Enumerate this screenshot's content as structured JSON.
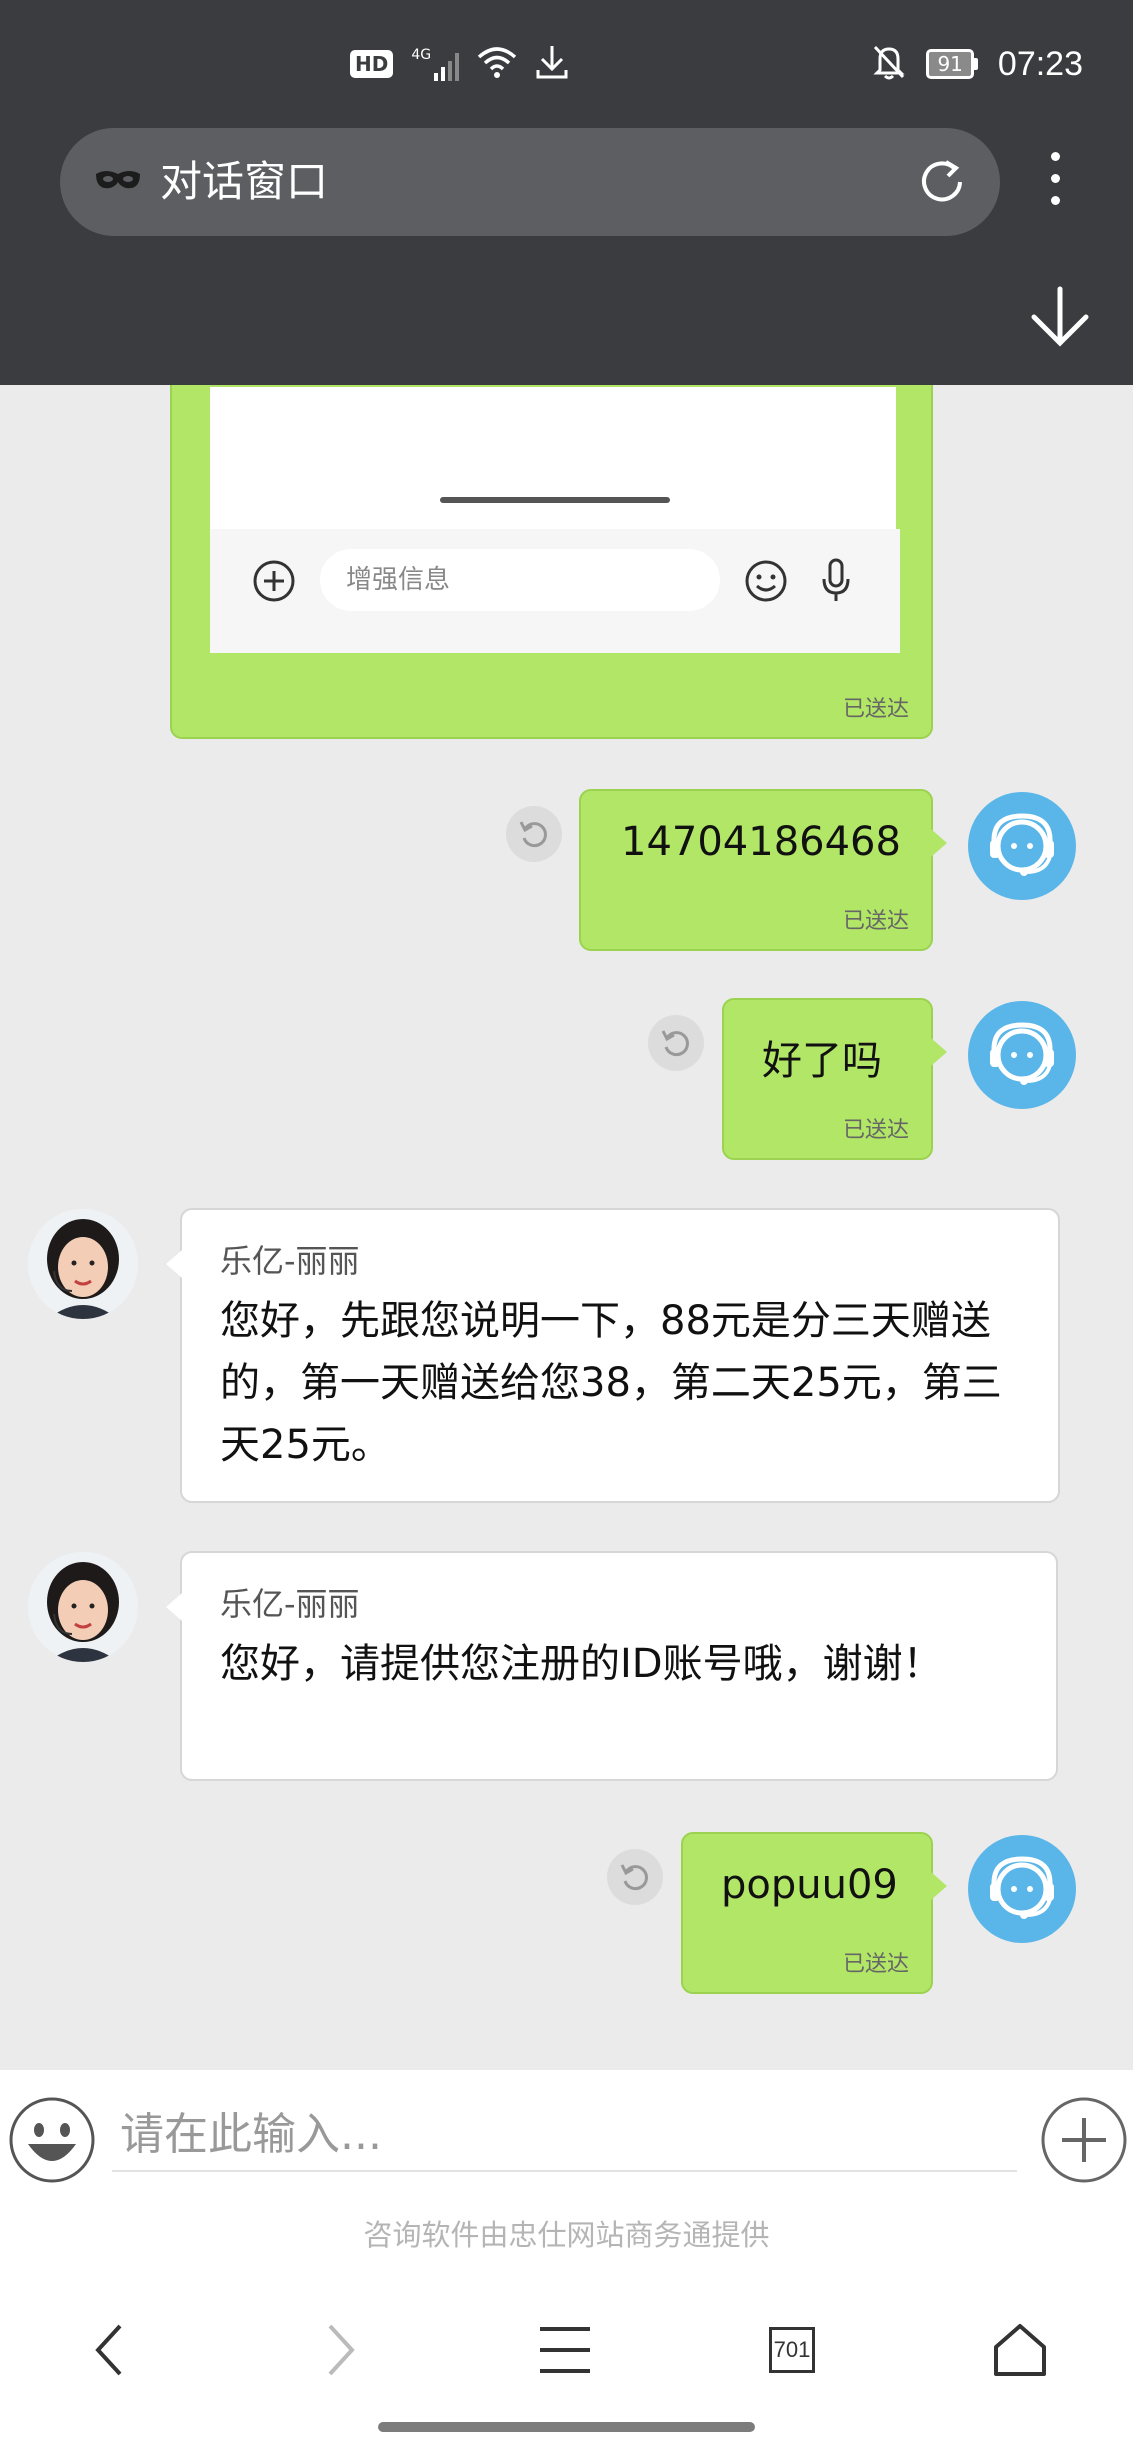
{
  "status_bar": {
    "hd": "HD",
    "network": "4G",
    "battery": "91",
    "time": "07:23"
  },
  "browser": {
    "title": "对话窗口",
    "icons": [
      "incognito-mask-icon",
      "reload-icon",
      "more-vert-icon",
      "download-arrow-icon"
    ]
  },
  "screenshot_preview": {
    "input_placeholder": "增强信息"
  },
  "messages": [
    {
      "side": "right",
      "type": "image",
      "status": "已送达"
    },
    {
      "side": "right",
      "text": "14704186468",
      "status": "已送达"
    },
    {
      "side": "right",
      "text": "好了吗",
      "status": "已送达"
    },
    {
      "side": "left",
      "sender": "乐亿-丽丽",
      "text": "您好，先跟您说明一下，88元是分三天赠送的，第一天赠送给您38，第二天25元，第三天25元。"
    },
    {
      "side": "left",
      "sender": "乐亿-丽丽",
      "text": "您好，请提供您注册的ID账号哦，谢谢！"
    },
    {
      "side": "right",
      "text": "popuu09",
      "status": "已送达"
    }
  ],
  "input": {
    "placeholder": "请在此输入..."
  },
  "footer": {
    "note": "咨询软件由忠仕网站商务通提供"
  },
  "nav": {
    "tab_count": "701"
  },
  "colors": {
    "topbar": "#3b3c40",
    "sent_bubble": "#b2e667",
    "agent_avatar": "#5ab6e8",
    "chat_bg": "#ebebeb"
  }
}
